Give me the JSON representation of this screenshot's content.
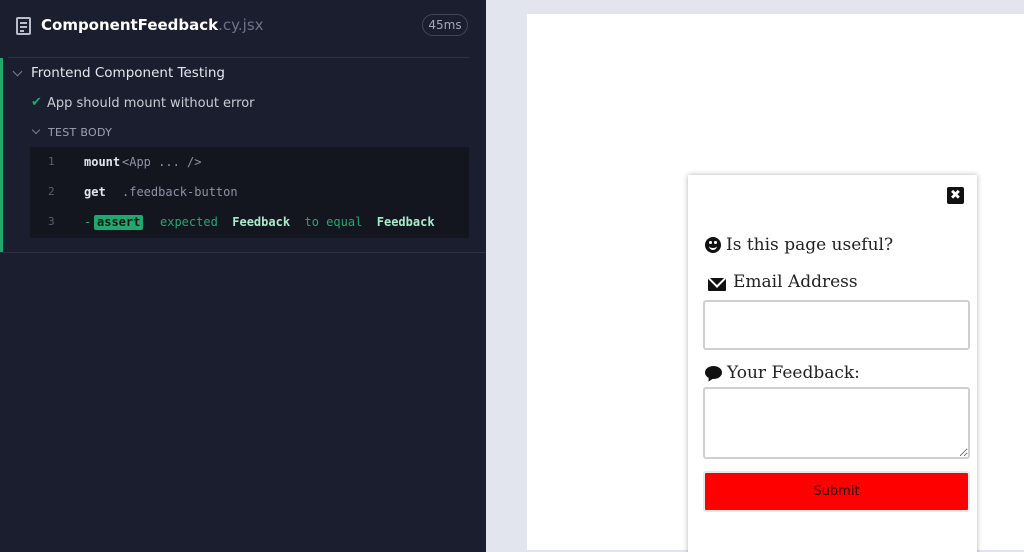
{
  "reporter": {
    "spec_file_icon": "file-text-icon",
    "spec_name": "ComponentFeedback",
    "spec_ext": ".cy.jsx",
    "duration": "45ms",
    "suite_title": "Frontend Component Testing",
    "test": {
      "status_icon": "check-icon",
      "status_symbol": "✔",
      "title": "App should mount without error",
      "body_label": "TEST BODY"
    },
    "commands": [
      {
        "num": "1",
        "name": "mount",
        "message": "<App ... />"
      },
      {
        "num": "2",
        "name": "get",
        "message": ".feedback-button"
      },
      {
        "num": "3",
        "dash": "-",
        "badge": "assert",
        "message_prefix": "expected",
        "expected": "Feedback",
        "message_mid": "to equal",
        "actual": "Feedback"
      }
    ],
    "colors": {
      "pass": "#1fa971",
      "background": "#1b1e2e"
    }
  },
  "aut": {
    "close_icon": "close-icon",
    "close_symbol": "✖",
    "question": "Is this page useful?",
    "question_icon": "smile-icon",
    "email_label": "Email Address",
    "email_icon": "envelope-icon",
    "email_value": "",
    "feedback_label": "Your Feedback:",
    "feedback_icon": "comment-icon",
    "feedback_value": "",
    "submit_label": "Submit",
    "colors": {
      "submit": "#ff0000"
    }
  }
}
